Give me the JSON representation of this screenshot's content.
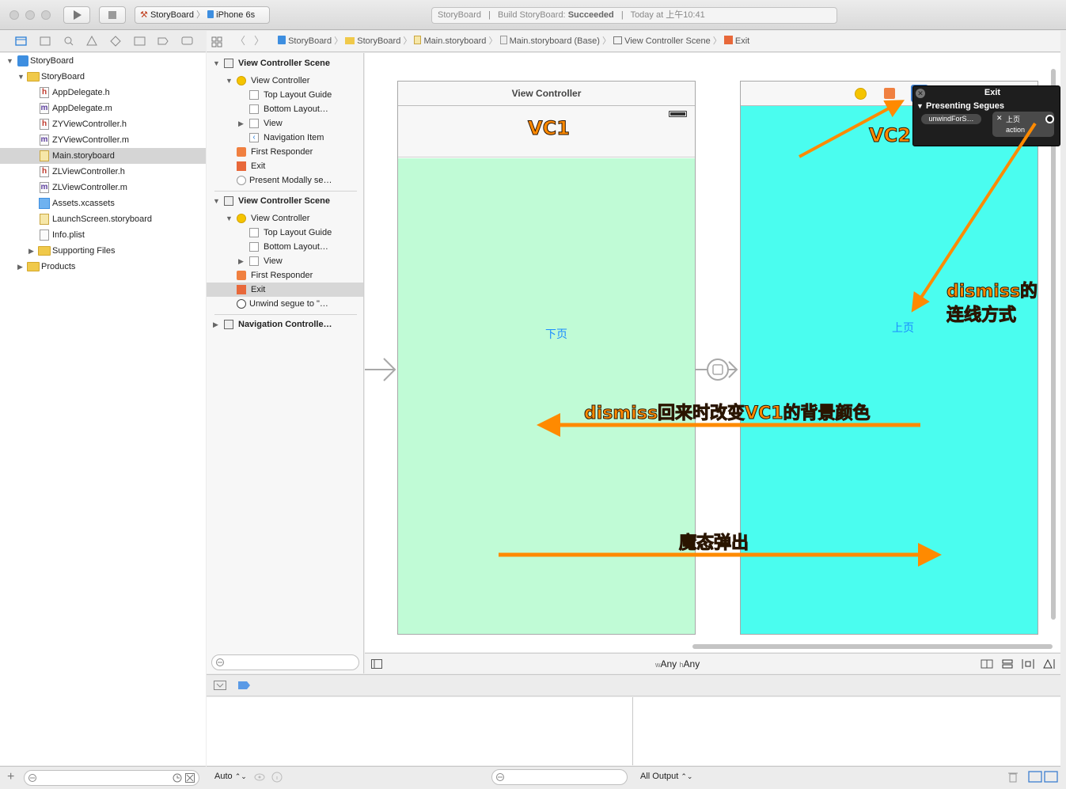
{
  "toolbar": {
    "scheme_project": "StoryBoard",
    "scheme_device": "iPhone 6s",
    "status_project": "StoryBoard",
    "status_build_prefix": "Build StoryBoard:",
    "status_build_result": "Succeeded",
    "status_time": "Today at 上午10:41"
  },
  "navigator": {
    "items": [
      {
        "label": "StoryBoard"
      },
      {
        "label": "StoryBoard"
      },
      {
        "label": "AppDelegate.h",
        "badge": "h"
      },
      {
        "label": "AppDelegate.m",
        "badge": "m"
      },
      {
        "label": "ZYViewController.h",
        "badge": "h"
      },
      {
        "label": "ZYViewController.m",
        "badge": "m"
      },
      {
        "label": "Main.storyboard"
      },
      {
        "label": "ZLViewController.h",
        "badge": "h"
      },
      {
        "label": "ZLViewController.m",
        "badge": "m"
      },
      {
        "label": "Assets.xcassets"
      },
      {
        "label": "LaunchScreen.storyboard"
      },
      {
        "label": "Info.plist"
      },
      {
        "label": "Supporting Files"
      },
      {
        "label": "Products"
      }
    ]
  },
  "jumpbar": {
    "crumbs": [
      "StoryBoard",
      "StoryBoard",
      "Main.storyboard",
      "Main.storyboard (Base)",
      "View Controller Scene",
      "Exit"
    ]
  },
  "outline": {
    "scene1": {
      "title": "View Controller Scene",
      "controller": "View Controller",
      "top_guide": "Top Layout Guide",
      "bottom_guide": "Bottom Layout…",
      "view": "View",
      "nav_item": "Navigation Item",
      "responder": "First Responder",
      "exit": "Exit",
      "segue": "Present Modally se…"
    },
    "scene2": {
      "title": "View Controller Scene",
      "controller": "View Controller",
      "top_guide": "Top Layout Guide",
      "bottom_guide": "Bottom Layout…",
      "view": "View",
      "responder": "First Responder",
      "exit": "Exit",
      "segue": "Unwind segue to \"…"
    },
    "scene3": {
      "title": "Navigation Controlle…"
    }
  },
  "canvas": {
    "vc1_title": "View Controller",
    "vc1_button": "下页",
    "vc2_button": "上页",
    "vc1_color": "#c0fbd6",
    "vc2_color": "#4afdef",
    "size_class_w_prefix": "w",
    "size_class_w": "Any",
    "size_class_h_prefix": "h",
    "size_class_h": "Any"
  },
  "popup": {
    "title": "Exit",
    "section": "Presenting Segues",
    "segue_name": "unwindForS…",
    "target_label": "上页",
    "target_sub": "action"
  },
  "annotations": {
    "vc1": "VC1",
    "vc2": "VC2",
    "dismiss_line": "dismiss的",
    "dismiss_line2": "连线方式",
    "dismiss_back": "dismiss回来时改变VC1的背景颜色",
    "modal": "魔态弹出"
  },
  "debug": {
    "auto_label": "Auto",
    "output_label": "All Output"
  },
  "colors": {
    "accent": "#ff8a00",
    "link": "#1a8cff"
  }
}
